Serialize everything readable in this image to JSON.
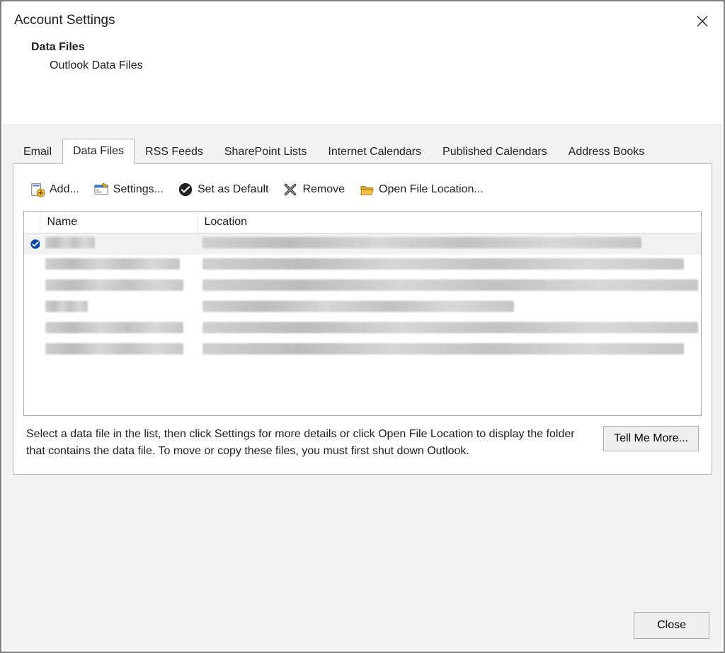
{
  "header": {
    "title": "Account Settings",
    "section_title": "Data Files",
    "section_subtitle": "Outlook Data Files"
  },
  "tabs": [
    {
      "label": "Email",
      "active": false
    },
    {
      "label": "Data Files",
      "active": true
    },
    {
      "label": "RSS Feeds",
      "active": false
    },
    {
      "label": "SharePoint Lists",
      "active": false
    },
    {
      "label": "Internet Calendars",
      "active": false
    },
    {
      "label": "Published Calendars",
      "active": false
    },
    {
      "label": "Address Books",
      "active": false
    }
  ],
  "toolbar": {
    "add": "Add...",
    "settings": "Settings...",
    "default": "Set as Default",
    "remove": "Remove",
    "open": "Open File Location..."
  },
  "table": {
    "columns": {
      "name": "Name",
      "location": "Location"
    },
    "rows": [
      {
        "default": true,
        "name_w": 70,
        "loc_w": 620
      },
      {
        "default": false,
        "name_w": 190,
        "loc_w": 680
      },
      {
        "default": false,
        "name_w": 195,
        "loc_w": 700
      },
      {
        "default": false,
        "name_w": 60,
        "loc_w": 440
      },
      {
        "default": false,
        "name_w": 195,
        "loc_w": 700
      },
      {
        "default": false,
        "name_w": 195,
        "loc_w": 680
      }
    ]
  },
  "help_text": "Select a data file in the list, then click Settings for more details or click Open File Location to display the folder that contains the data file. To move or copy these files, you must first shut down Outlook.",
  "buttons": {
    "tell_me_more": "Tell Me More...",
    "close": "Close"
  }
}
